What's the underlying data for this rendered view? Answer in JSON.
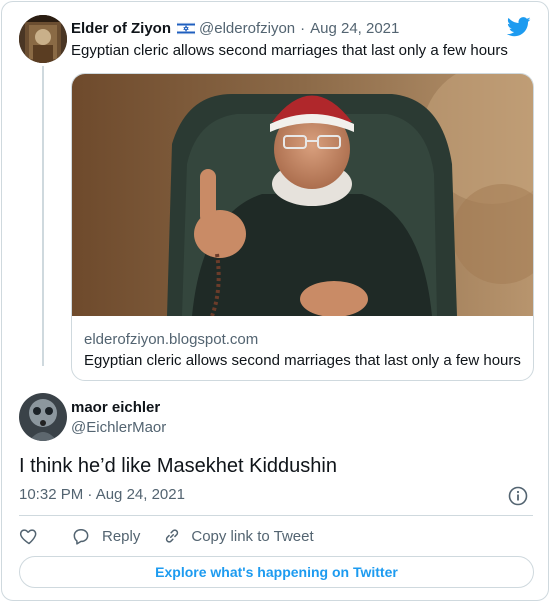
{
  "parent_tweet": {
    "author_name": "Elder of Ziyon",
    "handle": "@elderofziyon",
    "separator": "·",
    "date": "Aug 24, 2021",
    "text": "Egyptian cleric allows second marriages that last only a few hours",
    "flag_icon": "israel-flag-icon",
    "link_card": {
      "domain": "elderofziyon.blogspot.com",
      "title": "Egyptian cleric allows second marriages that last only a few hours"
    }
  },
  "reply_tweet": {
    "author_name": "maor eichler",
    "handle": "@EichlerMaor",
    "text": "I think he’d like Masekhet Kiddushin",
    "timestamp": "10:32 PM · Aug 24, 2021"
  },
  "actions": {
    "like_icon": "heart-icon",
    "reply_label": "Reply",
    "copy_label": "Copy link to Tweet"
  },
  "explore_label": "Explore what's happening on Twitter",
  "colors": {
    "accent": "#1d9bf0",
    "text": "#0f1419",
    "muted": "#536471",
    "border": "#cfd9de"
  }
}
